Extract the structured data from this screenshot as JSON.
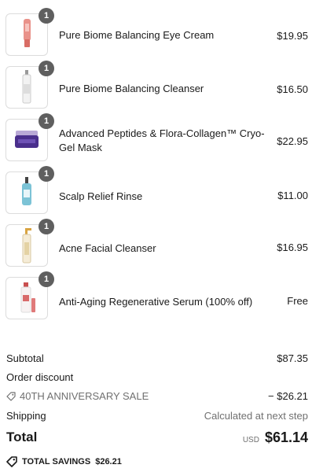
{
  "line_items": [
    {
      "qty": "1",
      "name": "Pure Biome Balancing Eye Cream",
      "price": "$19.95",
      "image_icon": "eye-cream-tube-icon"
    },
    {
      "qty": "1",
      "name": "Pure Biome Balancing Cleanser",
      "price": "$16.50",
      "image_icon": "cleanser-bottle-icon"
    },
    {
      "qty": "1",
      "name": "Advanced Peptides & Flora-Collagen™ Cryo-Gel Mask",
      "price": "$22.95",
      "image_icon": "gel-mask-jar-icon"
    },
    {
      "qty": "1",
      "name": "Scalp Relief Rinse",
      "price": "$11.00",
      "image_icon": "scalp-rinse-bottle-icon"
    },
    {
      "qty": "1",
      "name": "Acne Facial Cleanser",
      "price": "$16.95",
      "image_icon": "pump-bottle-icon"
    },
    {
      "qty": "1",
      "name": "Anti-Aging Regenerative Serum (100% off)",
      "price": "Free",
      "image_icon": "serum-bottle-icon"
    }
  ],
  "summary": {
    "subtotal_label": "Subtotal",
    "subtotal_value": "$87.35",
    "order_discount_label": "Order discount",
    "discount_code": "40TH ANNIVERSARY SALE",
    "discount_value": "− $26.21",
    "shipping_label": "Shipping",
    "shipping_value": "Calculated at next step",
    "total_label": "Total",
    "currency": "USD",
    "total_value": "$61.14",
    "savings_label": "TOTAL SAVINGS",
    "savings_value": "$26.21"
  },
  "colors": {
    "badge": "#5f5f5f",
    "text": "#1a1a1a",
    "muted": "#707070",
    "border": "#dcdcdc"
  }
}
